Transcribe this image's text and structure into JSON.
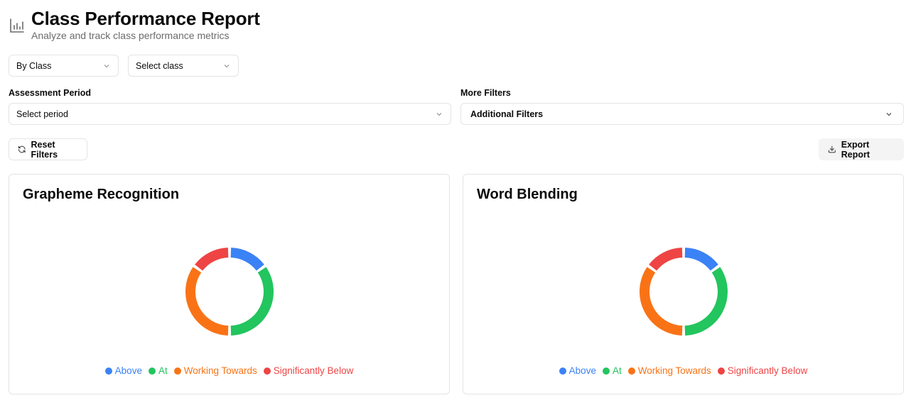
{
  "header": {
    "title": "Class Performance Report",
    "subtitle": "Analyze and track class performance metrics",
    "icon": "bar-chart-icon"
  },
  "filters": {
    "mode_select": "By Class",
    "class_select": "Select class",
    "period_label": "Assessment Period",
    "period_select": "Select period",
    "more_label": "More Filters",
    "more_select": "Additional Filters"
  },
  "actions": {
    "reset": "Reset Filters",
    "export": "Export Report"
  },
  "colors": {
    "above": "#3b82f6",
    "at": "#22c55e",
    "working_towards": "#f97316",
    "significantly_below": "#ef4444"
  },
  "chart_data": [
    {
      "type": "pie",
      "title": "Grapheme Recognition",
      "categories": [
        "Above",
        "At",
        "Working Towards",
        "Significantly Below"
      ],
      "values": [
        15,
        35,
        35,
        15
      ],
      "donut": true
    },
    {
      "type": "pie",
      "title": "Word Blending",
      "categories": [
        "Above",
        "At",
        "Working Towards",
        "Significantly Below"
      ],
      "values": [
        15,
        35,
        35,
        15
      ],
      "donut": true
    }
  ]
}
